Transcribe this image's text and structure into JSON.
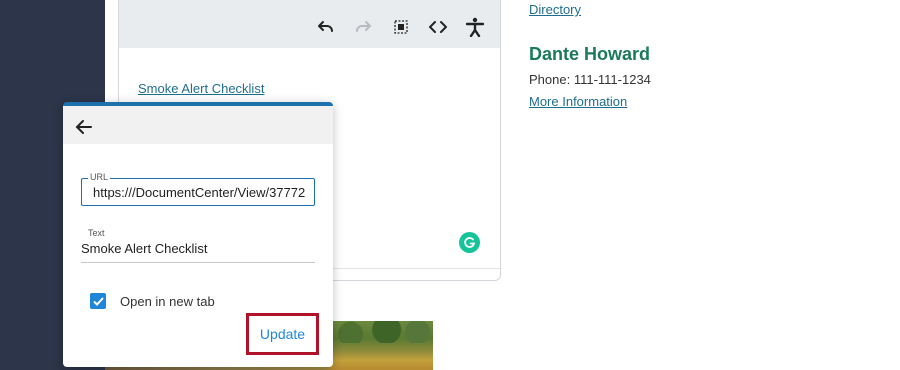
{
  "editor": {
    "toolbar": {
      "undo_icon": "undo-icon",
      "redo_icon": "redo-icon",
      "select_icon": "select-all-icon",
      "code_icon": "code-icon",
      "accessibility_icon": "accessibility-icon"
    },
    "link_text": "Smoke Alert Checklist",
    "grammarly_icon": "grammarly-icon"
  },
  "contact": {
    "directory_link": "Directory",
    "name": "Dante Howard",
    "phone": "Phone: 111-111-1234",
    "more_link": "More Information"
  },
  "link_popup": {
    "back_icon": "back-arrow-icon",
    "url_label": "URL",
    "url_value": "https:///DocumentCenter/View/37772",
    "text_label": "Text",
    "text_value": "Smoke Alert Checklist",
    "open_new_tab_label": "Open in new tab",
    "open_new_tab_checked": true,
    "update_label": "Update"
  },
  "colors": {
    "accent_blue": "#1f87d8",
    "name_green": "#1b7a5a",
    "highlight_red": "#b0122a",
    "left_rail": "#2c3549"
  }
}
